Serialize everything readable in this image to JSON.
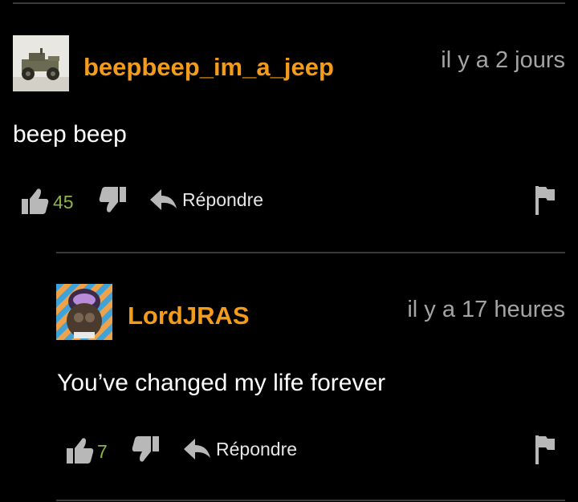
{
  "colors": {
    "background": "#000000",
    "username": "#f39b1a",
    "timestamp": "#a4a4a4",
    "body_text": "#ffffff",
    "vote_count": "#8fb24a",
    "icon": "#b8b8b8",
    "divider": "#3a3a3a"
  },
  "comments": [
    {
      "username": "beepbeep_im_a_jeep",
      "avatar_icon": "jeep-avatar",
      "timestamp": "il y a 2 jours",
      "text": "beep beep",
      "upvotes": "45",
      "reply_label": "Répondre"
    },
    {
      "username": "LordJRAS",
      "avatar_icon": "figure-avatar",
      "timestamp": "il y a 17 heures",
      "text": "You’ve changed my life forever",
      "upvotes": "7",
      "reply_label": "Répondre"
    }
  ],
  "icons": {
    "upvote": "thumbs-up-icon",
    "downvote": "thumbs-down-icon",
    "reply": "reply-arrow-icon",
    "flag": "flag-icon"
  }
}
